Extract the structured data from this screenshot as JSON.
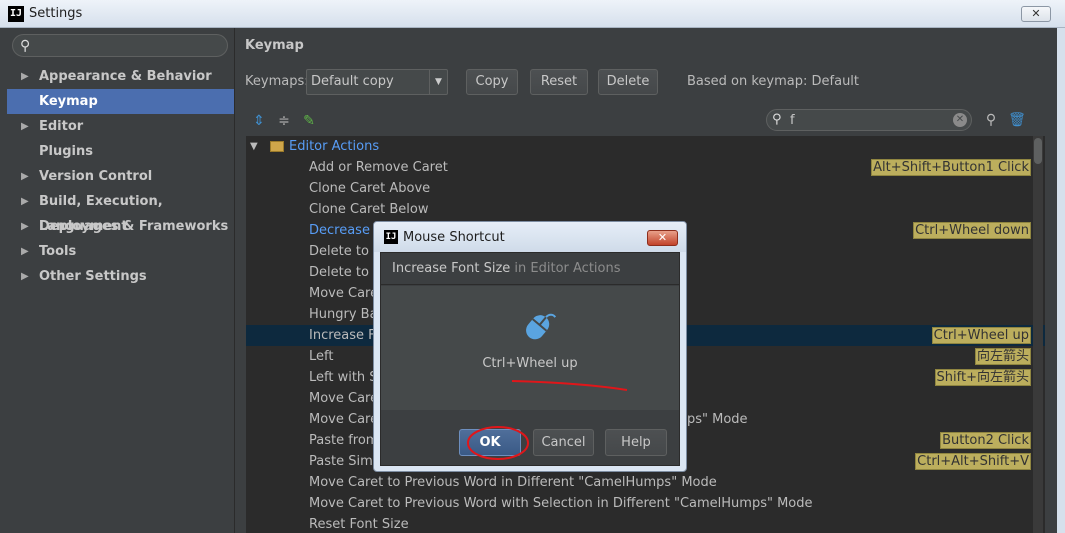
{
  "window": {
    "title": "Settings",
    "app_icon": "IJ",
    "close_glyph": "✕"
  },
  "sidebar": {
    "search_placeholder": "",
    "items": [
      {
        "label": "Appearance & Behavior",
        "arrow": "▶"
      },
      {
        "label": "Keymap",
        "arrow": ""
      },
      {
        "label": "Editor",
        "arrow": "▶"
      },
      {
        "label": "Plugins",
        "arrow": ""
      },
      {
        "label": "Version Control",
        "arrow": "▶"
      },
      {
        "label": "Build, Execution, Deployment",
        "arrow": "▶"
      },
      {
        "label": "Languages & Frameworks",
        "arrow": "▶"
      },
      {
        "label": "Tools",
        "arrow": "▶"
      },
      {
        "label": "Other Settings",
        "arrow": "▶"
      }
    ]
  },
  "main": {
    "title": "Keymap",
    "keymaps_label": "Keymaps:",
    "keymap_value": "Default copy",
    "copy_label": "Copy",
    "reset_label": "Reset",
    "delete_label": "Delete",
    "based_on": "Based on keymap: Default",
    "filter_value": "f"
  },
  "tree": {
    "group": "Editor Actions",
    "rows": [
      {
        "label": "Add or Remove Caret",
        "shortcut": "Alt+Shift+Button1 Click"
      },
      {
        "label": "Clone Caret Above",
        "shortcut": ""
      },
      {
        "label": "Clone Caret Below",
        "shortcut": ""
      },
      {
        "label": "Decrease F",
        "shortcut": "Ctrl+Wheel down"
      },
      {
        "label": "Delete to W",
        "shortcut": ""
      },
      {
        "label": "Delete to W",
        "shortcut": ""
      },
      {
        "label": "Move Care",
        "shortcut": ""
      },
      {
        "label": "Hungry Bac",
        "shortcut": ""
      },
      {
        "label": "Increase F",
        "shortcut": "Ctrl+Wheel up"
      },
      {
        "label": "Left",
        "shortcut": "向左箭头"
      },
      {
        "label": "Left with Se",
        "shortcut": "Shift+向左箭头"
      },
      {
        "label": "Move Care",
        "shortcut": ""
      },
      {
        "label": "Move Care",
        "shortcut": ""
      },
      {
        "label": "Paste from",
        "shortcut": "Button2 Click"
      },
      {
        "label": "Paste Simp",
        "shortcut": "Ctrl+Alt+Shift+V"
      },
      {
        "label": "Move Caret to Previous Word in Different \"CamelHumps\" Mode",
        "shortcut": ""
      },
      {
        "label": "Move Caret to Previous Word with Selection in Different \"CamelHumps\" Mode",
        "shortcut": ""
      },
      {
        "label": "Reset Font Size",
        "shortcut": ""
      }
    ],
    "row12_suffix": "ps\" Mode"
  },
  "dialog": {
    "title": "Mouse Shortcut",
    "action": "Increase Font Size",
    "context": "in Editor Actions",
    "shortcut": "Ctrl+Wheel up",
    "ok_label": "OK",
    "cancel_label": "Cancel",
    "help_label": "Help",
    "close_glyph": "✕"
  },
  "colors": {
    "accent": "#4b6eaf",
    "selection": "#0d293e",
    "shortcut_bg": "#bcae5d",
    "annotation": "#e0161a"
  }
}
